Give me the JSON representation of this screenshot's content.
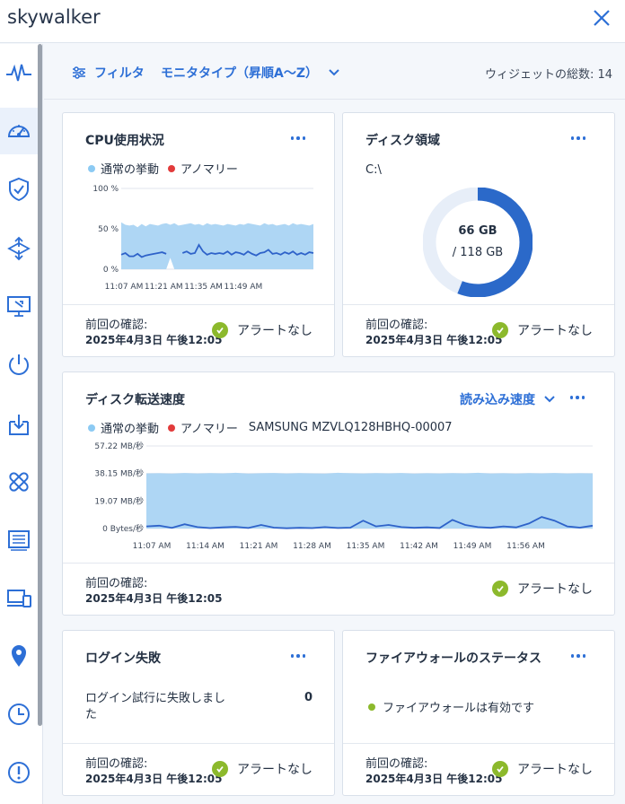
{
  "window": {
    "title": "skywalker"
  },
  "toolbar": {
    "filter_label": "フィルタ",
    "sort_label": "モニタタイプ（昇順A〜Z）",
    "widget_count_label": "ウィジェットの総数: 14"
  },
  "sidebar": {
    "items": [
      {
        "icon": "activity-icon"
      },
      {
        "icon": "dashboard-gauge-icon"
      },
      {
        "icon": "shield-check-icon"
      },
      {
        "icon": "network-transfer-icon"
      },
      {
        "icon": "remote-desktop-icon"
      },
      {
        "icon": "power-icon"
      },
      {
        "icon": "download-tray-icon"
      },
      {
        "icon": "patch-bandage-icon"
      },
      {
        "icon": "hardware-list-icon"
      },
      {
        "icon": "devices-icon"
      },
      {
        "icon": "location-pin-icon"
      },
      {
        "icon": "clock-icon"
      },
      {
        "icon": "alert-icon"
      }
    ]
  },
  "legend": {
    "normal": "通常の挙動",
    "anomaly": "アノマリー"
  },
  "footer": {
    "last_checked_label": "前回の確認:",
    "last_checked_date": "2025年4月3日 午後12:05",
    "no_alerts": "アラートなし"
  },
  "cpu_card": {
    "title": "CPU使用状況"
  },
  "disk_space_card": {
    "title": "ディスク領域",
    "drive": "C:\\",
    "used_label": "66 GB",
    "total_label": "/ 118 GB",
    "used_fraction": 0.56
  },
  "disk_transfer_card": {
    "title": "ディスク転送速度",
    "rate_selector": "読み込み速度",
    "device": "SAMSUNG MZVLQ128HBHQ-00007"
  },
  "login_card": {
    "title": "ログイン失敗",
    "text": "ログイン試行に失敗しました",
    "value": "0"
  },
  "firewall_card": {
    "title": "ファイアウォールのステータス",
    "status": "ファイアウォールは有効です"
  },
  "colors": {
    "accent": "#2d6fd6",
    "normal_band": "#aed6f4",
    "normal_dot": "#8ccaf3",
    "anomaly": "#e23b3b",
    "line": "#2e62c9",
    "ok": "#8cb92c",
    "donut_used": "#2b69c9",
    "donut_track": "#e7eef8"
  },
  "chart_data": [
    {
      "type": "area",
      "title": "CPU使用状況",
      "yticks": [
        "100 %",
        "50 %",
        "0 %"
      ],
      "ylim": [
        0,
        100
      ],
      "xticks": [
        "11:07 AM",
        "11:21 AM",
        "11:35 AM",
        "11:49 AM"
      ],
      "series": [
        {
          "name": "通常の挙動",
          "upper": [
            58,
            55,
            54,
            55,
            52,
            56,
            53,
            56,
            55,
            54,
            56,
            57,
            55,
            57,
            54,
            55,
            56,
            57,
            55,
            56,
            54,
            57,
            55,
            56,
            55,
            54,
            56,
            55,
            54,
            56,
            55,
            57,
            56,
            55,
            54,
            57,
            55,
            56,
            54,
            55,
            56,
            54,
            57,
            55,
            56,
            55,
            54,
            56
          ],
          "lower": [
            0,
            0,
            0,
            0,
            0,
            0,
            0,
            0,
            0,
            0,
            0,
            0,
            14,
            0,
            0,
            0,
            0,
            0,
            0,
            0,
            0,
            0,
            0,
            0,
            0,
            0,
            0,
            0,
            0,
            0,
            0,
            0,
            0,
            0,
            0,
            0,
            0,
            0,
            0,
            0,
            0,
            0,
            0,
            0,
            0,
            0,
            0,
            0
          ]
        },
        {
          "name": "CPU",
          "values": [
            18,
            20,
            16,
            16,
            19,
            15,
            17,
            18,
            19,
            20,
            21,
            19,
            null,
            null,
            null,
            20,
            22,
            19,
            20,
            30,
            22,
            18,
            20,
            19,
            20,
            19,
            22,
            18,
            21,
            20,
            18,
            22,
            19,
            17,
            20,
            21,
            24,
            19,
            20,
            18,
            21,
            19,
            22,
            18,
            20,
            18,
            21,
            20
          ]
        }
      ]
    },
    {
      "type": "area",
      "title": "ディスク転送速度",
      "yticks": [
        "57.22 MB/秒",
        "38.15 MB/秒",
        "19.07 MB/秒",
        "0 Bytes/秒"
      ],
      "ylim": [
        0,
        57.22
      ],
      "xticks": [
        "11:07 AM",
        "11:14 AM",
        "11:21 AM",
        "11:28 AM",
        "11:35 AM",
        "11:42 AM",
        "11:49 AM",
        "11:56 AM"
      ],
      "series": [
        {
          "name": "通常の挙動",
          "upper": [
            38.2,
            38.3,
            38.0,
            38.5,
            38.1,
            38.4,
            38.2,
            38.6,
            38.0,
            38.3,
            38.5,
            38.1,
            38.4,
            38.2,
            38.0,
            38.6,
            38.3,
            38.1,
            38.4,
            38.2,
            38.5,
            38.0,
            38.3,
            38.1,
            38.4,
            38.2,
            38.6,
            38.1,
            38.3,
            38.0,
            38.4,
            38.2,
            38.5,
            38.1,
            38.3,
            38.2
          ],
          "lower": [
            0,
            0,
            0,
            0,
            0,
            0,
            0,
            0,
            0,
            0,
            0,
            0,
            0,
            0,
            0,
            0,
            0,
            0,
            0,
            0,
            0,
            0,
            0,
            0,
            0,
            0,
            0,
            0,
            0,
            0,
            0,
            0,
            0,
            0,
            0,
            0
          ]
        },
        {
          "name": "読み込み速度",
          "values": [
            1.5,
            2.0,
            0.5,
            3.0,
            1.0,
            0.3,
            0.8,
            1.2,
            0.4,
            2.5,
            0.6,
            0.2,
            0.5,
            0.3,
            1.0,
            0.4,
            0.6,
            5.5,
            1.5,
            2.5,
            1.0,
            0.5,
            0.8,
            0.4,
            6.0,
            2.5,
            1.0,
            0.5,
            1.5,
            0.8,
            3.5,
            8.0,
            5.5,
            1.5,
            0.6,
            2.0
          ]
        }
      ]
    }
  ]
}
